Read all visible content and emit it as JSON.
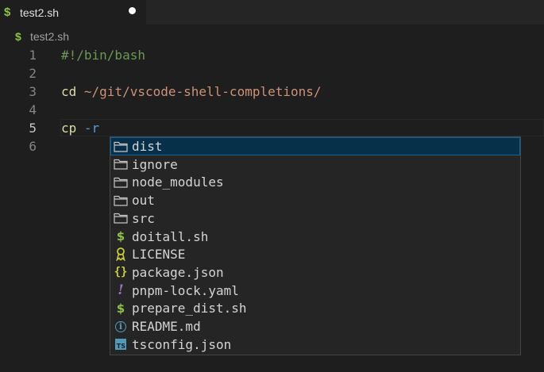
{
  "tab": {
    "icon": "shell-dollar-icon",
    "title": "test2.sh",
    "dirty": true
  },
  "breadcrumb": {
    "icon": "shell-dollar-icon",
    "label": "test2.sh"
  },
  "editor": {
    "current_line": 5,
    "lines": [
      {
        "number": "1",
        "tokens": [
          {
            "text": "#!/bin/bash",
            "kind": "comment"
          }
        ]
      },
      {
        "number": "2",
        "tokens": []
      },
      {
        "number": "3",
        "tokens": [
          {
            "text": "cd",
            "kind": "cmd"
          },
          {
            "text": " ",
            "kind": "plain"
          },
          {
            "text": "~/git/vscode-shell-completions/",
            "kind": "str"
          }
        ]
      },
      {
        "number": "4",
        "tokens": []
      },
      {
        "number": "5",
        "tokens": [
          {
            "text": "cp",
            "kind": "cmd"
          },
          {
            "text": " ",
            "kind": "plain"
          },
          {
            "text": "-r",
            "kind": "flag"
          }
        ]
      },
      {
        "number": "6",
        "tokens": []
      }
    ]
  },
  "suggestions": {
    "selected_index": 0,
    "items": [
      {
        "label": "dist",
        "icon": "folder-icon"
      },
      {
        "label": "ignore",
        "icon": "folder-icon"
      },
      {
        "label": "node_modules",
        "icon": "folder-icon"
      },
      {
        "label": "out",
        "icon": "folder-icon"
      },
      {
        "label": "src",
        "icon": "folder-icon"
      },
      {
        "label": "doitall.sh",
        "icon": "shell-dollar-icon"
      },
      {
        "label": "LICENSE",
        "icon": "license-icon"
      },
      {
        "label": "package.json",
        "icon": "json-braces-icon"
      },
      {
        "label": "pnpm-lock.yaml",
        "icon": "yaml-exclamation-icon"
      },
      {
        "label": "prepare_dist.sh",
        "icon": "shell-dollar-icon"
      },
      {
        "label": "README.md",
        "icon": "info-icon"
      },
      {
        "label": "tsconfig.json",
        "icon": "typescript-icon"
      }
    ]
  },
  "colors": {
    "editor_bg": "#1e1e1e",
    "tabbar_bg": "#252526",
    "selection_bg": "#062f4a",
    "selection_border": "#0e639c",
    "shell_green": "#8dc149"
  }
}
